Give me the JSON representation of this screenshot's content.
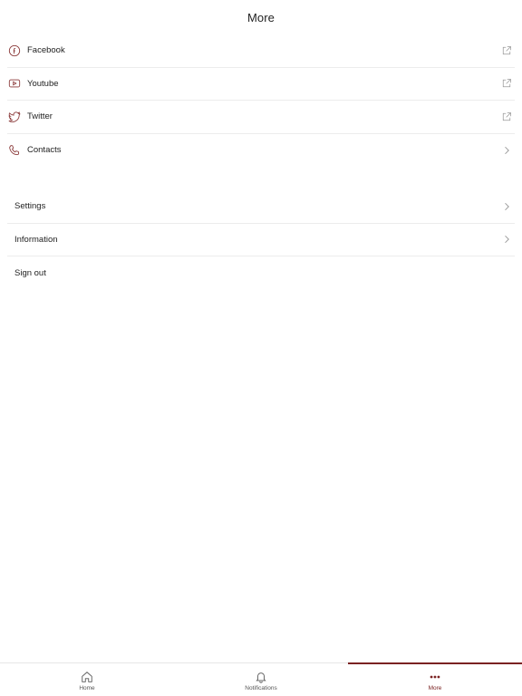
{
  "header": {
    "title": "More"
  },
  "social": [
    {
      "label": "Facebook",
      "icon": "facebook-icon",
      "trail": "external-link-icon"
    },
    {
      "label": "Youtube",
      "icon": "youtube-icon",
      "trail": "external-link-icon"
    },
    {
      "label": "Twitter",
      "icon": "twitter-icon",
      "trail": "external-link-icon"
    },
    {
      "label": "Contacts",
      "icon": "phone-icon",
      "trail": "chevron-right-icon"
    }
  ],
  "general": [
    {
      "label": "Settings",
      "trail": "chevron-right-icon"
    },
    {
      "label": "Information",
      "trail": "chevron-right-icon"
    },
    {
      "label": "Sign out"
    }
  ],
  "tabs": [
    {
      "label": "Home",
      "icon": "home-icon",
      "active": false
    },
    {
      "label": "Notifications",
      "icon": "bell-icon",
      "active": false
    },
    {
      "label": "More",
      "icon": "more-dots-icon",
      "active": true
    }
  ],
  "colors": {
    "accent": "#7a2222",
    "icon": "#8b3a3a",
    "divider": "#ececec"
  }
}
